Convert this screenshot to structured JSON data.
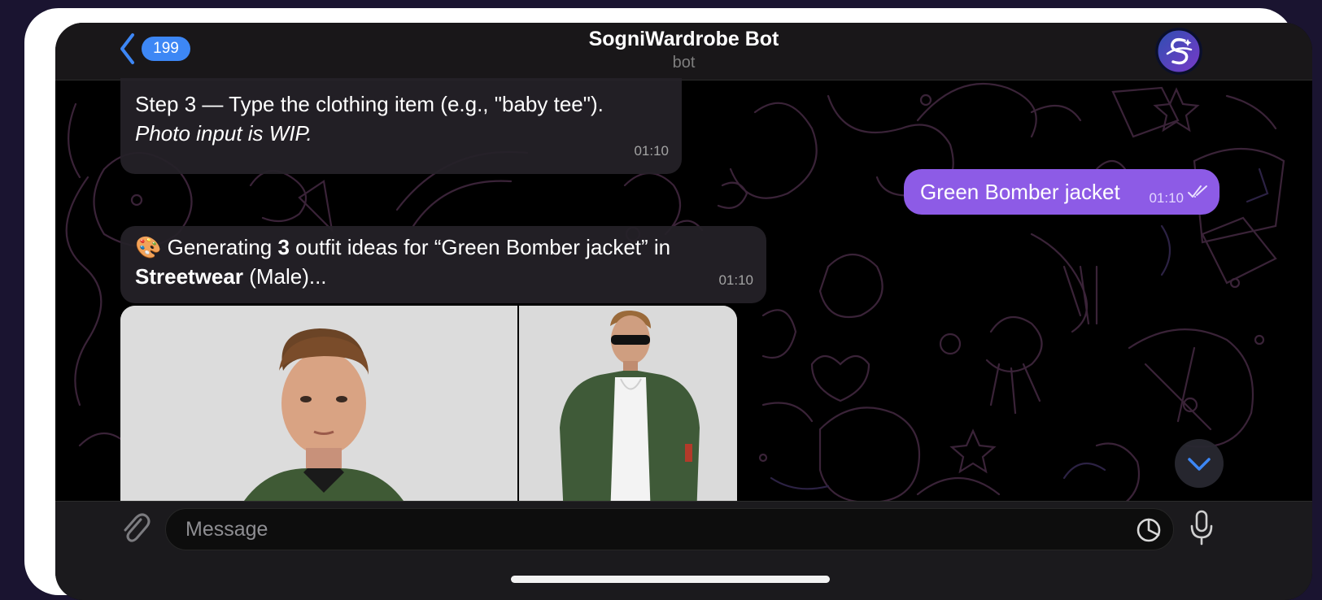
{
  "header": {
    "back_count": "199",
    "title": "SogniWardrobe Bot",
    "subtitle": "bot"
  },
  "messages": [
    {
      "direction": "incoming",
      "line1": "Step 3 — Type the clothing item (e.g., \"baby tee\").",
      "line2": "Photo input is WIP.",
      "time": "01:10"
    },
    {
      "direction": "outgoing",
      "text": "Green Bomber jacket",
      "time": "01:10",
      "status": "read"
    },
    {
      "direction": "incoming",
      "emoji": "🎨",
      "text_before_count": " Generating ",
      "count": "3",
      "text_after_count": " outfit ideas for “Green Bomber jacket” in",
      "style": "Streetwear",
      "gender_suffix": " (Male)...",
      "time": "01:10"
    }
  ],
  "input": {
    "placeholder": "Message"
  },
  "colors": {
    "accent": "#3d87f5",
    "outgoing_bubble": "#8d5be6",
    "incoming_bubble": "#252128",
    "background": "#000000"
  },
  "icons": {
    "back": "chevron-left-icon",
    "attach": "paperclip-icon",
    "sticker": "sticker-icon",
    "mic": "microphone-icon",
    "scroll": "chevron-down-icon"
  }
}
